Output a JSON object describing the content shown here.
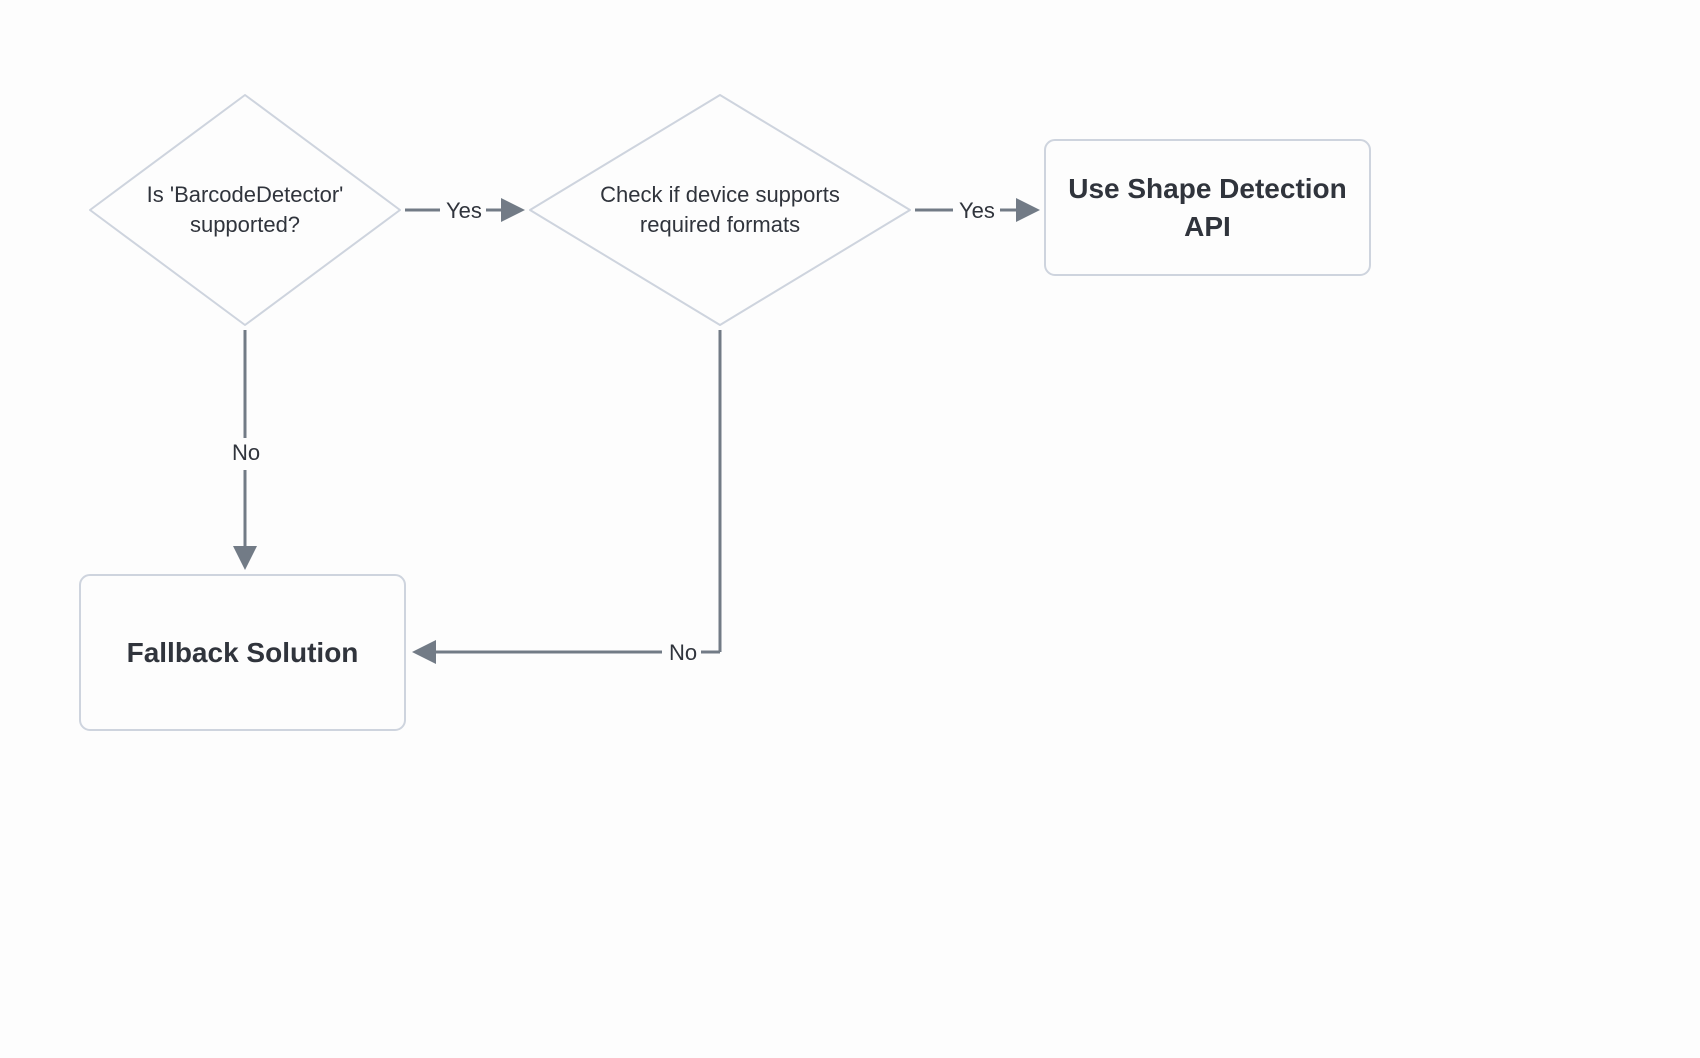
{
  "diagram": {
    "nodes": {
      "decision1": {
        "line1": "Is 'BarcodeDetector'",
        "line2": "supported?"
      },
      "decision2": {
        "line1": "Check if device supports",
        "line2": "required formats"
      },
      "result1": "Use Shape Detection API",
      "result2": "Fallback Solution"
    },
    "edges": {
      "yes1": "Yes",
      "yes2": "Yes",
      "no1": "No",
      "no2": "No"
    },
    "colors": {
      "stroke_light": "#ced4de",
      "stroke_dark": "#727b86",
      "text": "#30343c"
    }
  }
}
